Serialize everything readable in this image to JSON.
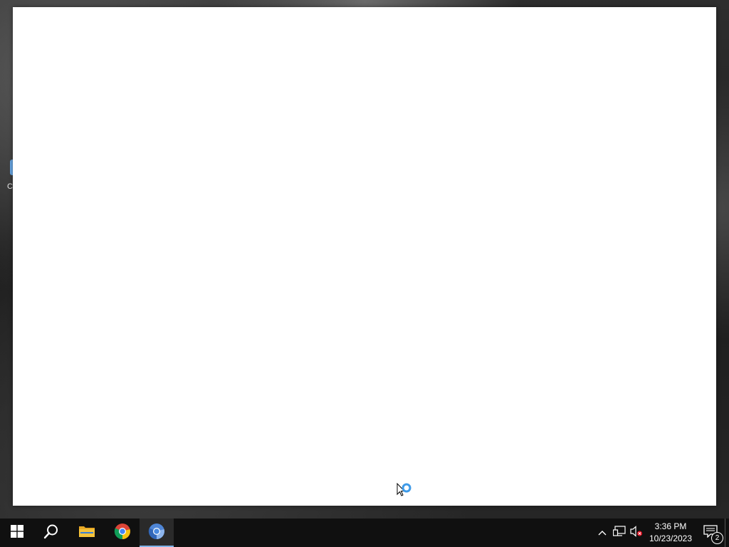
{
  "desktop": {
    "icon_fragment_text": "C"
  },
  "window": {
    "state": "blank-loading"
  },
  "taskbar": {
    "start_icon": "windows-logo-icon",
    "pinned": [
      {
        "name": "search",
        "icon": "search-icon"
      },
      {
        "name": "file-explorer",
        "icon": "folder-icon"
      },
      {
        "name": "google-chrome",
        "icon": "chrome-icon"
      },
      {
        "name": "chromium",
        "icon": "chromium-icon",
        "active": true
      }
    ],
    "tray": {
      "icons": [
        "chevron-up-icon",
        "network-icon",
        "volume-muted-icon"
      ],
      "time": "3:36 PM",
      "date": "10/23/2023",
      "notification_count": "2"
    }
  },
  "colors": {
    "taskbar_bg": "#101010",
    "active_indicator": "#7fb3e8",
    "window_bg": "#ffffff",
    "busy_ring": "#3d9ae8"
  }
}
